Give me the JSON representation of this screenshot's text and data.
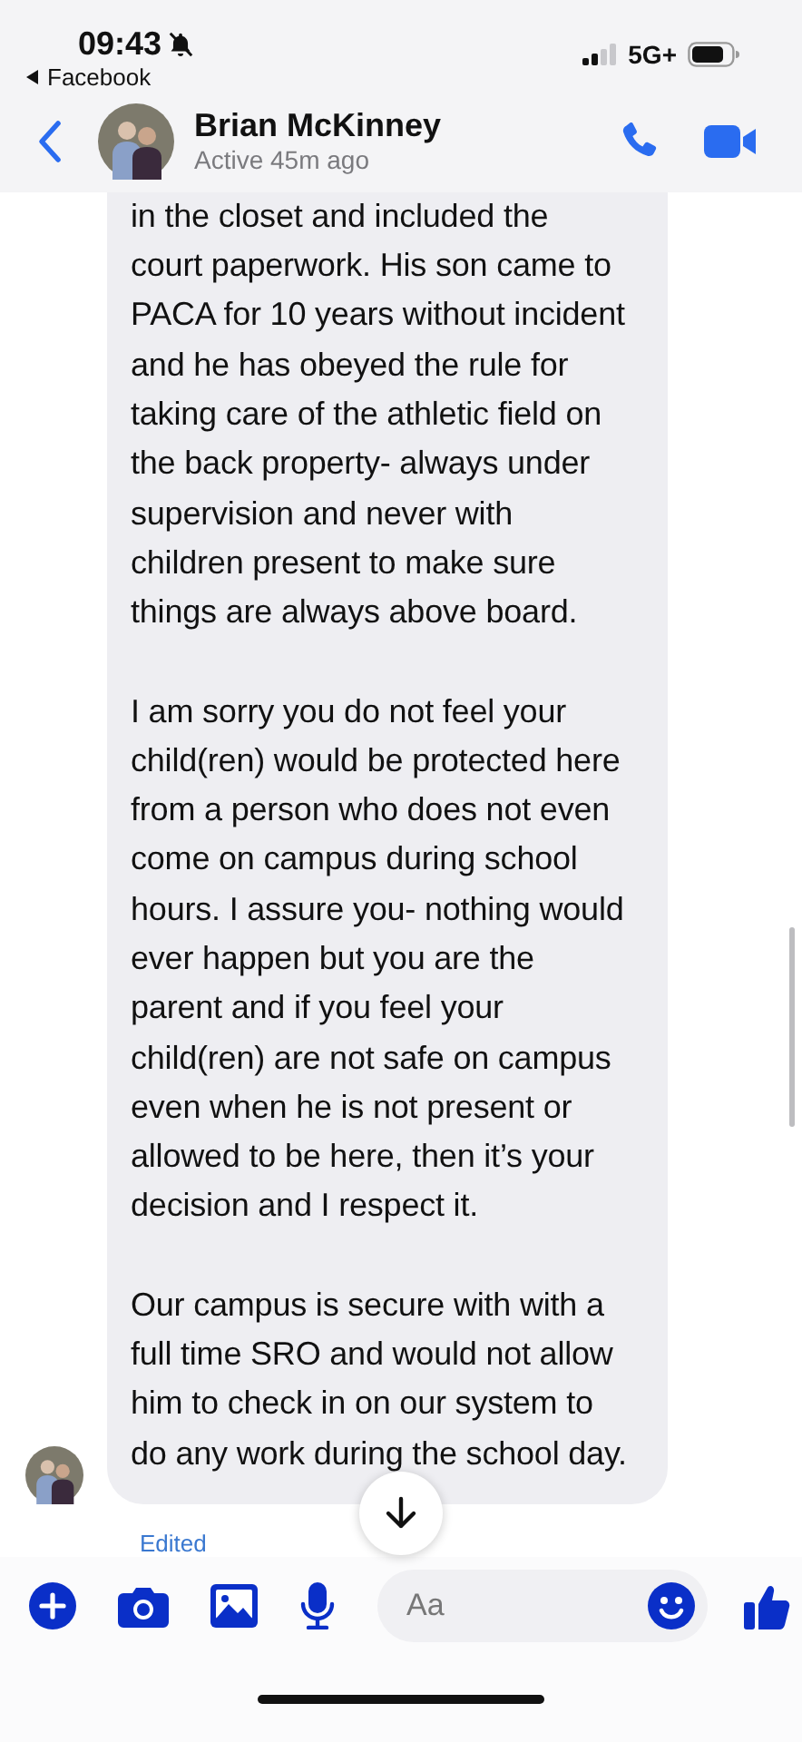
{
  "status_bar": {
    "time": "09:43",
    "back_app": "Facebook",
    "network": "5G+"
  },
  "header": {
    "name": "Brian McKinney",
    "status": "Active 45m ago"
  },
  "message": {
    "paragraphs": [
      "in the closet and included the court paperwork. His son came to PACA for 10 years without incident and he has obeyed the rule for taking care of the athletic field on the back property- always under supervision and never with children present to make sure things are always above board.",
      "I am sorry you do not feel your child(ren) would be protected here from a person who does not even come on campus during school hours. I assure you- nothing would ever happen but you are the parent and if you feel your child(ren) are not safe on campus even when he is not present or allowed to be here, then it’s your decision and I respect it.",
      "Our campus is secure with with a full time SRO and would not allow him to check in on our system to do any work during the school day."
    ],
    "edited_label": "Edited"
  },
  "composer": {
    "placeholder": "Aa"
  }
}
